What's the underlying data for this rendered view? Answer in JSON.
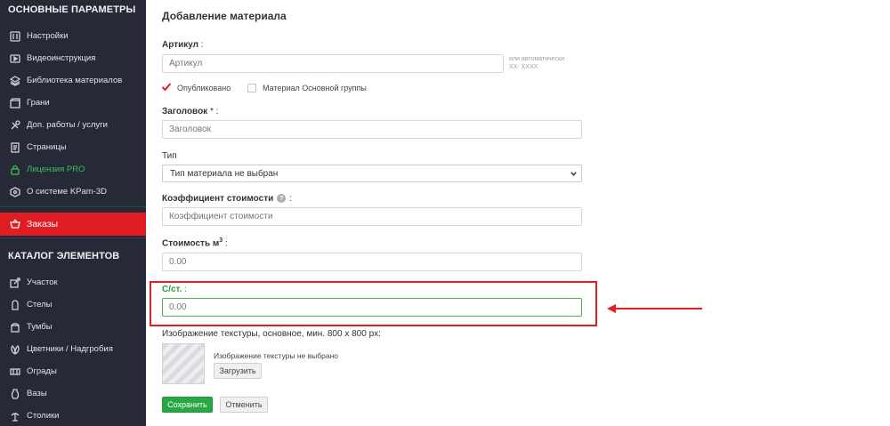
{
  "sidebar": {
    "section_main": "ОСНОВНЫЕ ПАРАМЕТРЫ",
    "items_main": [
      {
        "label": "Настройки",
        "icon": "sliders-icon"
      },
      {
        "label": "Видеоинструкция",
        "icon": "video-icon"
      },
      {
        "label": "Библиотека материалов",
        "icon": "layers-icon"
      },
      {
        "label": "Грани",
        "icon": "facets-icon"
      },
      {
        "label": "Доп. работы / услуги",
        "icon": "tools-icon"
      },
      {
        "label": "Страницы",
        "icon": "pages-icon"
      },
      {
        "label": "Лицензия PRO",
        "icon": "lock-icon"
      },
      {
        "label": "О системе KPam-3D",
        "icon": "info-icon"
      }
    ],
    "orders_label": "Заказы",
    "section_catalog": "КАТАЛОГ ЭЛЕМЕНТОВ",
    "items_catalog": [
      {
        "label": "Участок",
        "icon": "plot-icon"
      },
      {
        "label": "Стелы",
        "icon": "stele-icon"
      },
      {
        "label": "Тумбы",
        "icon": "pedestal-icon"
      },
      {
        "label": "Цветники / Надгробия",
        "icon": "flowerbed-icon"
      },
      {
        "label": "Ограды",
        "icon": "fence-icon"
      },
      {
        "label": "Вазы",
        "icon": "vase-icon"
      },
      {
        "label": "Столики",
        "icon": "table-icon"
      }
    ]
  },
  "form": {
    "title": "Добавление материала",
    "article_label": "Артикул",
    "article_placeholder": "Артикул",
    "article_hint_1": "или автоматически",
    "article_hint_2": "XX- XXXX",
    "published_label": "Опубликовано",
    "published_checked": true,
    "main_group_label": "Материал Основной группы",
    "main_group_checked": false,
    "heading_label": "Заголовок",
    "heading_placeholder": "Заголовок",
    "type_label": "Тип",
    "type_value": "Тип материала не выбран",
    "coef_label": "Коэффициент стоимости",
    "coef_placeholder": "Коэффициент стоимости",
    "cost_label": "Стоимость м",
    "cost_sup": "3",
    "cost_value": "0.00",
    "cst_label": "С/ст.",
    "cst_value": "0.00",
    "texture_label": "Изображение текстуры, основное, мин. 800 x 800 px:",
    "texture_note": "Изображение текстуры не выбрано",
    "upload_button": "Загрузить",
    "save_button": "Сохранить",
    "cancel_button": "Отменить"
  },
  "colors": {
    "sidebar_bg": "#262a36",
    "active_red": "#e11d24",
    "pro_green": "#3fbf5f",
    "save_green": "#28a745",
    "highlight_red": "#e01e24"
  }
}
